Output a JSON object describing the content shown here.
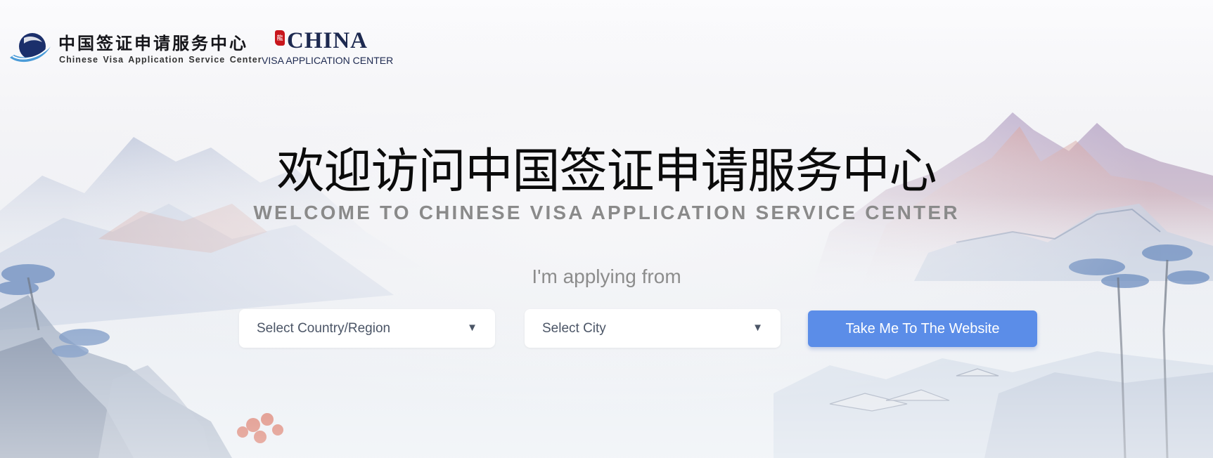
{
  "header": {
    "logo_cn": "中国签证申请服务中心",
    "logo_en": "Chinese Visa Application Service Center",
    "china_seal": "龍",
    "china_word": "CHINA",
    "china_sub": "VISA APPLICATION CENTER"
  },
  "hero": {
    "title_cn": "欢迎访问中国签证申请服务中心",
    "title_en": "WELCOME TO CHINESE VISA APPLICATION SERVICE CENTER",
    "applying_label": "I'm applying from"
  },
  "form": {
    "country_placeholder": "Select Country/Region",
    "city_placeholder": "Select City",
    "dropdown_icon": "triangle-down-icon",
    "submit_label": "Take Me To The Website"
  },
  "colors": {
    "button": "#5b8de8",
    "title": "#0b0b0b",
    "subtitle": "#8a8a8a",
    "logo_navy": "#1d2950",
    "seal_red": "#c8161d"
  }
}
